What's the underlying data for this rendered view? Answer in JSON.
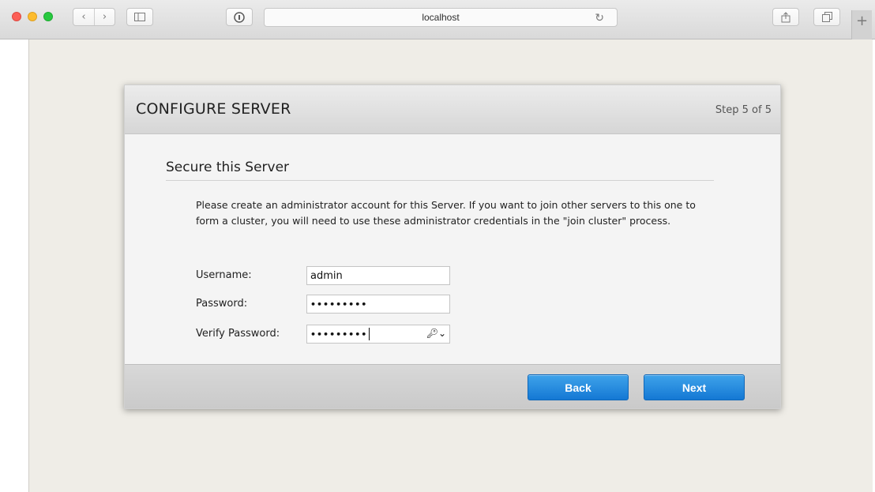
{
  "browser": {
    "url": "localhost",
    "icons": {
      "back": "chevron-left-icon",
      "forward": "chevron-right-icon",
      "sidebar": "sidebar-icon",
      "privacy": "privacy-info-icon",
      "reload": "reload-icon",
      "share": "share-icon",
      "tabs": "tabs-overview-icon",
      "new_tab": "plus-icon"
    }
  },
  "dialog": {
    "title": "CONFIGURE SERVER",
    "step": "Step 5 of 5",
    "section_title": "Secure this Server",
    "description": "Please create an administrator account for this Server. If you want to join other servers to this one to form a cluster, you will need to use these administrator credentials in the \"join cluster\" process.",
    "form": {
      "username_label": "Username:",
      "username_value": "admin",
      "password_label": "Password:",
      "password_value": "•••••••••",
      "verify_label": "Verify Password:",
      "verify_value": "•••••••••"
    },
    "buttons": {
      "back": "Back",
      "next": "Next"
    }
  },
  "colors": {
    "button_blue": "#1478d4",
    "page_background": "#efede7",
    "header_gray": "#d6d6d6"
  }
}
